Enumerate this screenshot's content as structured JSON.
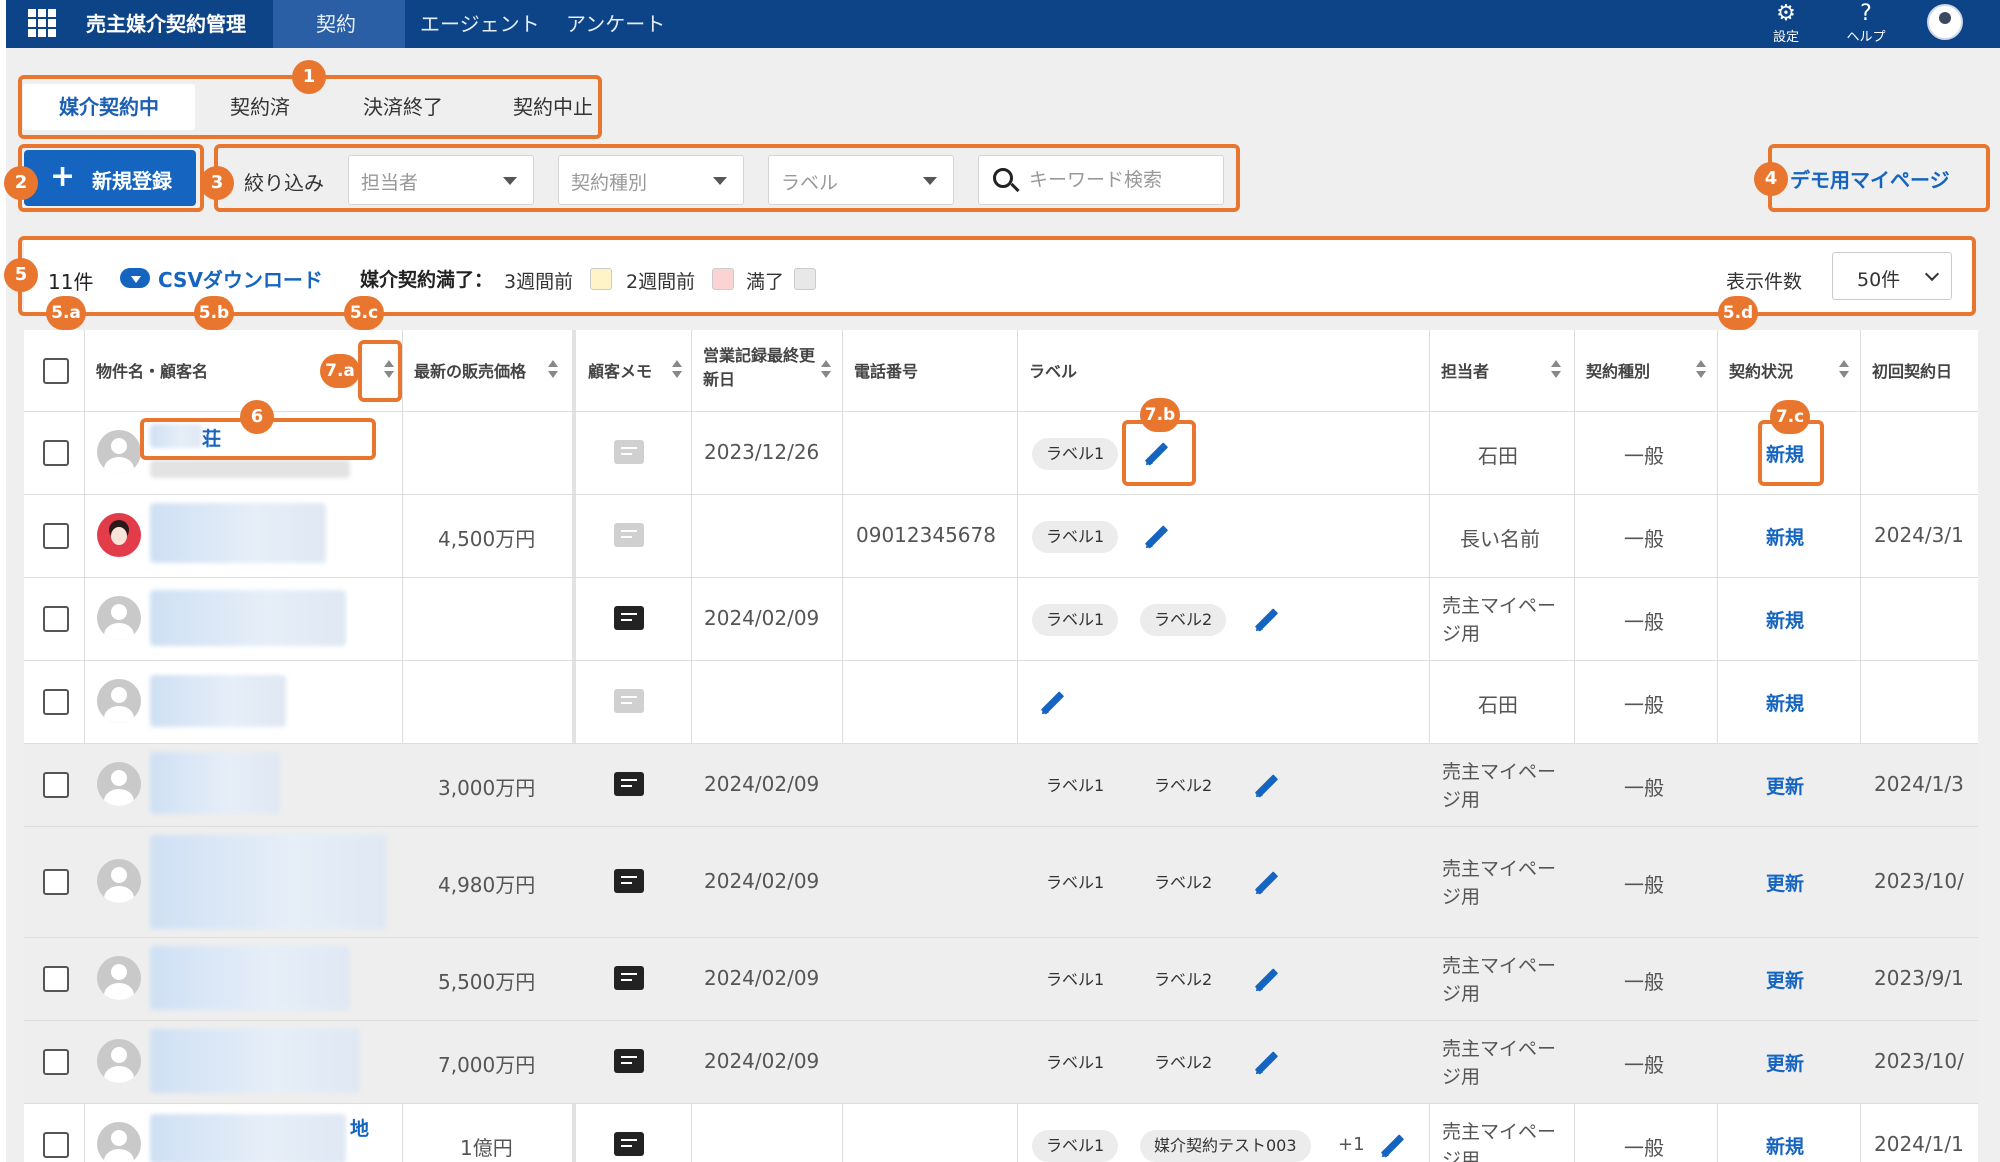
{
  "header": {
    "app_title": "売主媒介契約管理",
    "nav": [
      "契約",
      "エージェント",
      "アンケート"
    ],
    "settings_label": "設定",
    "help_label": "ヘルプ"
  },
  "tabs": [
    "媒介契約中",
    "契約済",
    "決済終了",
    "契約中止"
  ],
  "toolbar": {
    "new_button": "新規登録",
    "filter_label": "絞り込み",
    "selects": [
      "担当者",
      "契約種別",
      "ラベル"
    ],
    "search_placeholder": "キーワード検索",
    "demo_link": "デモ用マイページ"
  },
  "infobar": {
    "count": "11件",
    "csv_label": "CSVダウンロード",
    "legend_title": "媒介契約満了：",
    "legend": [
      {
        "label": "3週間前",
        "color": "#fff3c8"
      },
      {
        "label": "2週間前",
        "color": "#fbd3d3"
      },
      {
        "label": "満了",
        "color": "#e8e8e8"
      }
    ],
    "per_page_label": "表示件数",
    "per_page_value": "50件"
  },
  "table": {
    "columns": [
      "物件名・顧客名",
      "最新の販売価格",
      "顧客メモ",
      "営業記録最終更新日",
      "電話番号",
      "ラベル",
      "担当者",
      "契約種別",
      "契約状況",
      "初回契約日"
    ],
    "rows": [
      {
        "name_suffix": "荘",
        "price": "",
        "memo": "light",
        "updated": "2023/12/26",
        "phone": "",
        "labels": [
          "ラベル1"
        ],
        "staff": "石田",
        "type": "一般",
        "status": "新規",
        "first": ""
      },
      {
        "name_suffix": "",
        "price": "4,500万円",
        "memo": "light",
        "updated": "",
        "phone": "09012345678",
        "labels": [
          "ラベル1"
        ],
        "staff": "長い名前",
        "type": "一般",
        "status": "新規",
        "first": "2024/3/1"
      },
      {
        "name_suffix": "",
        "price": "",
        "memo": "dark",
        "updated": "2024/02/09",
        "phone": "",
        "labels": [
          "ラベル1",
          "ラベル2"
        ],
        "staff": "売主マイページ用",
        "type": "一般",
        "status": "新規",
        "first": ""
      },
      {
        "name_suffix": "",
        "price": "",
        "memo": "light",
        "updated": "",
        "phone": "",
        "labels": [],
        "staff": "石田",
        "type": "一般",
        "status": "新規",
        "first": ""
      },
      {
        "name_suffix": "",
        "price": "3,000万円",
        "memo": "dark",
        "updated": "2024/02/09",
        "phone": "",
        "labels": [
          "ラベル1",
          "ラベル2"
        ],
        "staff": "売主マイページ用",
        "type": "一般",
        "status": "更新",
        "first": "2024/1/3"
      },
      {
        "name_suffix": "",
        "price": "4,980万円",
        "memo": "dark",
        "updated": "2024/02/09",
        "phone": "",
        "labels": [
          "ラベル1",
          "ラベル2"
        ],
        "staff": "売主マイページ用",
        "type": "一般",
        "status": "更新",
        "first": "2023/10/"
      },
      {
        "name_suffix": "",
        "price": "5,500万円",
        "memo": "dark",
        "updated": "2024/02/09",
        "phone": "",
        "labels": [
          "ラベル1",
          "ラベル2"
        ],
        "staff": "売主マイページ用",
        "type": "一般",
        "status": "更新",
        "first": "2023/9/1"
      },
      {
        "name_suffix": "",
        "price": "7,000万円",
        "memo": "dark",
        "updated": "2024/02/09",
        "phone": "",
        "labels": [
          "ラベル1",
          "ラベル2"
        ],
        "staff": "売主マイページ用",
        "type": "一般",
        "status": "更新",
        "first": "2023/10/"
      },
      {
        "name_suffix": "地",
        "price": "1億円",
        "memo": "dark",
        "updated": "",
        "phone": "",
        "labels": [
          "ラベル1",
          "媒介契約テスト003"
        ],
        "labels_more": "+1",
        "staff": "売主マイページ用",
        "type": "一般",
        "status": "新規",
        "first": "2024/1/1"
      }
    ]
  },
  "annotations": [
    "1",
    "2",
    "3",
    "4",
    "5",
    "5.a",
    "5.b",
    "5.c",
    "5.d",
    "6",
    "7.a",
    "7.b",
    "7.c"
  ],
  "colors": {
    "nav_bg": "#0d4488",
    "primary": "#1565c0",
    "annotation": "#e8762f"
  }
}
